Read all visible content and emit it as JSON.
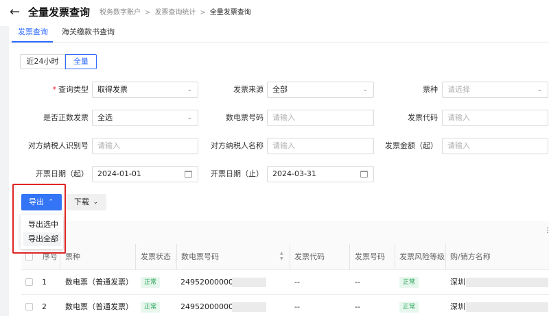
{
  "header": {
    "title": "全量发票查询",
    "breadcrumb": [
      "税务数字账户",
      "发票查询统计",
      "全量发票查询"
    ]
  },
  "tabs": [
    {
      "label": "发票查询",
      "active": true
    },
    {
      "label": "海关缴款书查询",
      "active": false
    }
  ],
  "range_toggle": {
    "options": [
      "近24小时",
      "全量"
    ],
    "selected": "全量"
  },
  "form": {
    "query_type": {
      "label": "查询类型",
      "required": true,
      "value": "取得发票"
    },
    "invoice_source": {
      "label": "发票来源",
      "value": "全部"
    },
    "ticket_kind": {
      "label": "票种",
      "placeholder": "请选择"
    },
    "is_positive": {
      "label": "是否正数发票",
      "value": "全选"
    },
    "digital_no": {
      "label": "数电票号码",
      "placeholder": "请输入"
    },
    "invoice_code": {
      "label": "发票代码",
      "placeholder": "请输入"
    },
    "counterparty_id": {
      "label": "对方纳税人识别号",
      "placeholder": "请输入"
    },
    "counterparty_name": {
      "label": "对方纳税人名称",
      "placeholder": "请输入"
    },
    "amount_start": {
      "label": "发票金额（起）",
      "placeholder": "请输入"
    },
    "date_start": {
      "label": "开票日期（起）",
      "value": "2024-01-01"
    },
    "date_end": {
      "label": "开票日期（止）",
      "value": "2024-03-31"
    }
  },
  "actions": {
    "export_label": "导出",
    "download_label": "下载",
    "export_menu": [
      "导出选中",
      "导出全部"
    ]
  },
  "table": {
    "columns": [
      "序号",
      "票种",
      "发票状态",
      "数电票号码",
      "发票代码",
      "发票号码",
      "发票风险等级",
      "购/销方名称"
    ],
    "rows": [
      {
        "index": "1",
        "kind": "数电票（普通发票）",
        "status": "正常",
        "number": "249520000000",
        "code": "--",
        "inv_no": "--",
        "risk": "正常",
        "party": "深圳"
      },
      {
        "index": "2",
        "kind": "数电票（普通发票）",
        "status": "正常",
        "number": "249520000000",
        "code": "--",
        "inv_no": "--",
        "risk": "正常",
        "party": "深圳"
      }
    ]
  },
  "theme": {
    "accent": "#3474f6",
    "highlight": "#e02424",
    "status_green": "#23a455"
  }
}
